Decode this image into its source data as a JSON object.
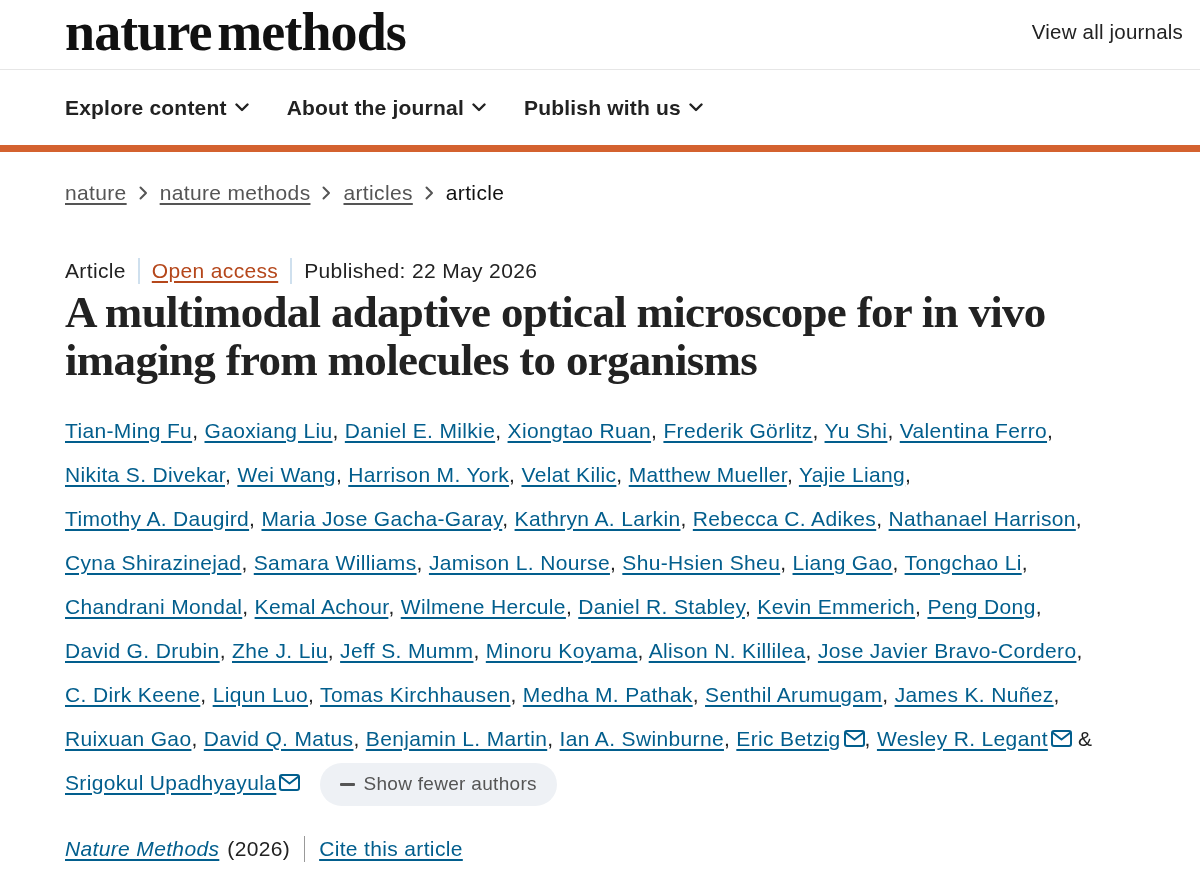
{
  "header": {
    "logo": "nature methods",
    "journals_link": "View all journals"
  },
  "nav": [
    {
      "label": "Explore content"
    },
    {
      "label": "About the journal"
    },
    {
      "label": "Publish with us"
    }
  ],
  "breadcrumbs": [
    {
      "label": "nature",
      "current": false
    },
    {
      "label": "nature methods",
      "current": false
    },
    {
      "label": "articles",
      "current": false
    },
    {
      "label": "article",
      "current": true
    }
  ],
  "article": {
    "type": "Article",
    "access": "Open access",
    "published": "Published: 22 May 2026",
    "title": "A multimodal adaptive optical microscope for in vivo imaging from molecules to organisms",
    "authors": [
      {
        "name": "Tian-Ming Fu",
        "contact": false,
        "separator": ","
      },
      {
        "name": "Gaoxiang Liu",
        "contact": false,
        "separator": ","
      },
      {
        "name": "Daniel E. Milkie",
        "contact": false,
        "separator": ","
      },
      {
        "name": "Xiongtao Ruan",
        "contact": false,
        "separator": ","
      },
      {
        "name": "Frederik Görlitz",
        "contact": false,
        "separator": ","
      },
      {
        "name": "Yu Shi",
        "contact": false,
        "separator": ","
      },
      {
        "name": "Valentina Ferro",
        "contact": false,
        "separator": ","
      },
      {
        "name": "Nikita S. Divekar",
        "contact": false,
        "separator": ","
      },
      {
        "name": "Wei Wang",
        "contact": false,
        "separator": ","
      },
      {
        "name": "Harrison M. York",
        "contact": false,
        "separator": ","
      },
      {
        "name": "Velat Kilic",
        "contact": false,
        "separator": ","
      },
      {
        "name": "Matthew Mueller",
        "contact": false,
        "separator": ","
      },
      {
        "name": "Yajie Liang",
        "contact": false,
        "separator": ","
      },
      {
        "name": "Timothy A. Daugird",
        "contact": false,
        "separator": ","
      },
      {
        "name": "Maria Jose Gacha-Garay",
        "contact": false,
        "separator": ","
      },
      {
        "name": "Kathryn A. Larkin",
        "contact": false,
        "separator": ","
      },
      {
        "name": "Rebecca C. Adikes",
        "contact": false,
        "separator": ","
      },
      {
        "name": "Nathanael Harrison",
        "contact": false,
        "separator": ","
      },
      {
        "name": "Cyna Shirazinejad",
        "contact": false,
        "separator": ","
      },
      {
        "name": "Samara Williams",
        "contact": false,
        "separator": ","
      },
      {
        "name": "Jamison L. Nourse",
        "contact": false,
        "separator": ","
      },
      {
        "name": "Shu-Hsien Sheu",
        "contact": false,
        "separator": ","
      },
      {
        "name": "Liang Gao",
        "contact": false,
        "separator": ","
      },
      {
        "name": "Tongchao Li",
        "contact": false,
        "separator": ","
      },
      {
        "name": "Chandrani Mondal",
        "contact": false,
        "separator": ","
      },
      {
        "name": "Kemal Achour",
        "contact": false,
        "separator": ","
      },
      {
        "name": "Wilmene Hercule",
        "contact": false,
        "separator": ","
      },
      {
        "name": "Daniel R. Stabley",
        "contact": false,
        "separator": ","
      },
      {
        "name": "Kevin Emmerich",
        "contact": false,
        "separator": ","
      },
      {
        "name": "Peng Dong",
        "contact": false,
        "separator": ","
      },
      {
        "name": "David G. Drubin",
        "contact": false,
        "separator": ","
      },
      {
        "name": "Zhe J. Liu",
        "contact": false,
        "separator": ","
      },
      {
        "name": "Jeff S. Mumm",
        "contact": false,
        "separator": ","
      },
      {
        "name": "Minoru Koyama",
        "contact": false,
        "separator": ","
      },
      {
        "name": "Alison N. Killilea",
        "contact": false,
        "separator": ","
      },
      {
        "name": "Jose Javier Bravo-Cordero",
        "contact": false,
        "separator": ","
      },
      {
        "name": "C. Dirk Keene",
        "contact": false,
        "separator": ","
      },
      {
        "name": "Liqun Luo",
        "contact": false,
        "separator": ","
      },
      {
        "name": "Tomas Kirchhausen",
        "contact": false,
        "separator": ","
      },
      {
        "name": "Medha M. Pathak",
        "contact": false,
        "separator": ","
      },
      {
        "name": "Senthil Arumugam",
        "contact": false,
        "separator": ","
      },
      {
        "name": "James K. Nuñez",
        "contact": false,
        "separator": ","
      },
      {
        "name": "Ruixuan Gao",
        "contact": false,
        "separator": ","
      },
      {
        "name": "David Q. Matus",
        "contact": false,
        "separator": ","
      },
      {
        "name": "Benjamin L. Martin",
        "contact": false,
        "separator": ","
      },
      {
        "name": "Ian A. Swinburne",
        "contact": false,
        "separator": ","
      },
      {
        "name": "Eric Betzig",
        "contact": true,
        "separator": ","
      },
      {
        "name": "Wesley R. Legant",
        "contact": true
      },
      {
        "name": "Srigokul Upadhyayula",
        "contact": true
      }
    ],
    "conjunction": "&",
    "authors_toggle": "Show fewer authors",
    "journal": "Nature Methods",
    "year": "(2026)",
    "cite": "Cite this article"
  }
}
